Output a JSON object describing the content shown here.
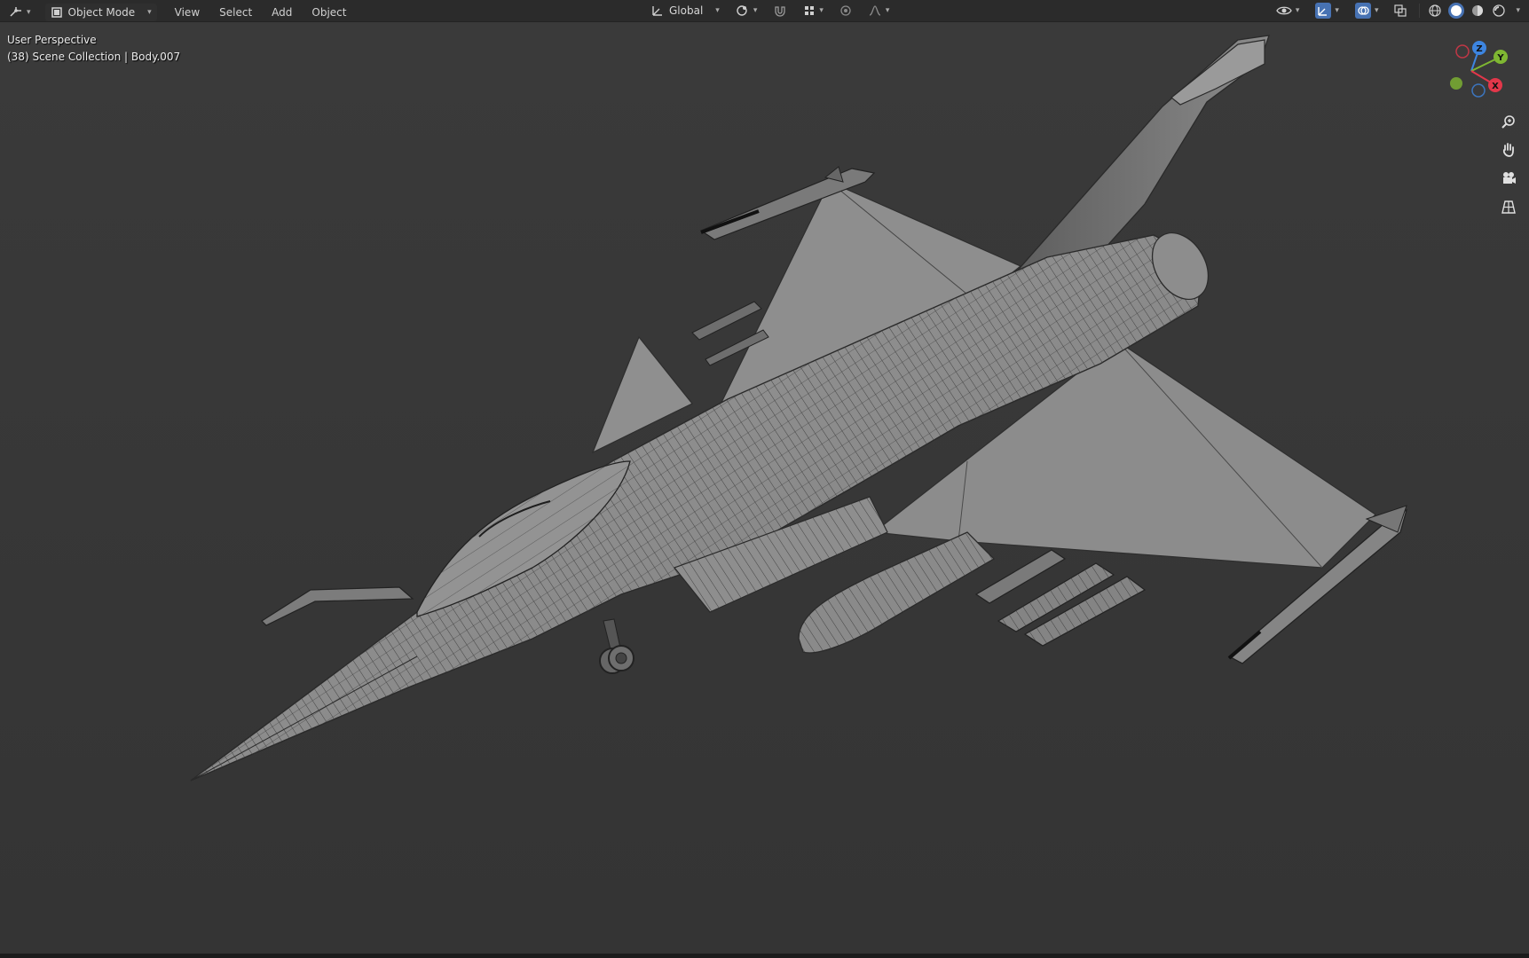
{
  "header": {
    "editor_type_icon": "3d-viewport-icon",
    "mode": {
      "label": "Object Mode",
      "icon": "object-mode-icon"
    },
    "menus": [
      "View",
      "Select",
      "Add",
      "Object"
    ],
    "transform_orientation": {
      "label": "Global",
      "icon": "orientation-global-icon"
    },
    "pivot_icon": "pivot-point-icon",
    "snap_icons": [
      "snap-magnet-icon",
      "snap-increment-icon"
    ],
    "proportional_icons": [
      "proportional-edit-icon",
      "falloff-curve-icon"
    ],
    "right_icons": [
      "visibility-eye-icon",
      "gizmo-toggle-icon",
      "overlay-toggle-icon",
      "xray-toggle-icon"
    ],
    "shading_modes": [
      "wireframe-shading-icon",
      "solid-shading-icon",
      "material-preview-icon",
      "rendered-shading-icon"
    ],
    "active_shading": "solid-shading-icon"
  },
  "overlay": {
    "view_name": "User Perspective",
    "collection_info": "(38) Scene Collection | Body.007"
  },
  "gizmo": {
    "axes": [
      "Z",
      "Y",
      "X"
    ],
    "colors": {
      "x": "#e2374a",
      "y": "#7fb732",
      "z": "#3d85e0"
    }
  },
  "nav_tools": [
    "zoom-icon",
    "pan-hand-icon",
    "camera-view-icon",
    "ortho-grid-icon"
  ],
  "colors": {
    "viewport_bg": "#3d3d3d",
    "header_bg": "#2b2b2b",
    "mesh_fill": "#8a8a8a",
    "wire": "#2a2a2a"
  },
  "scene_object": "jet-fighter-wireframe-model"
}
